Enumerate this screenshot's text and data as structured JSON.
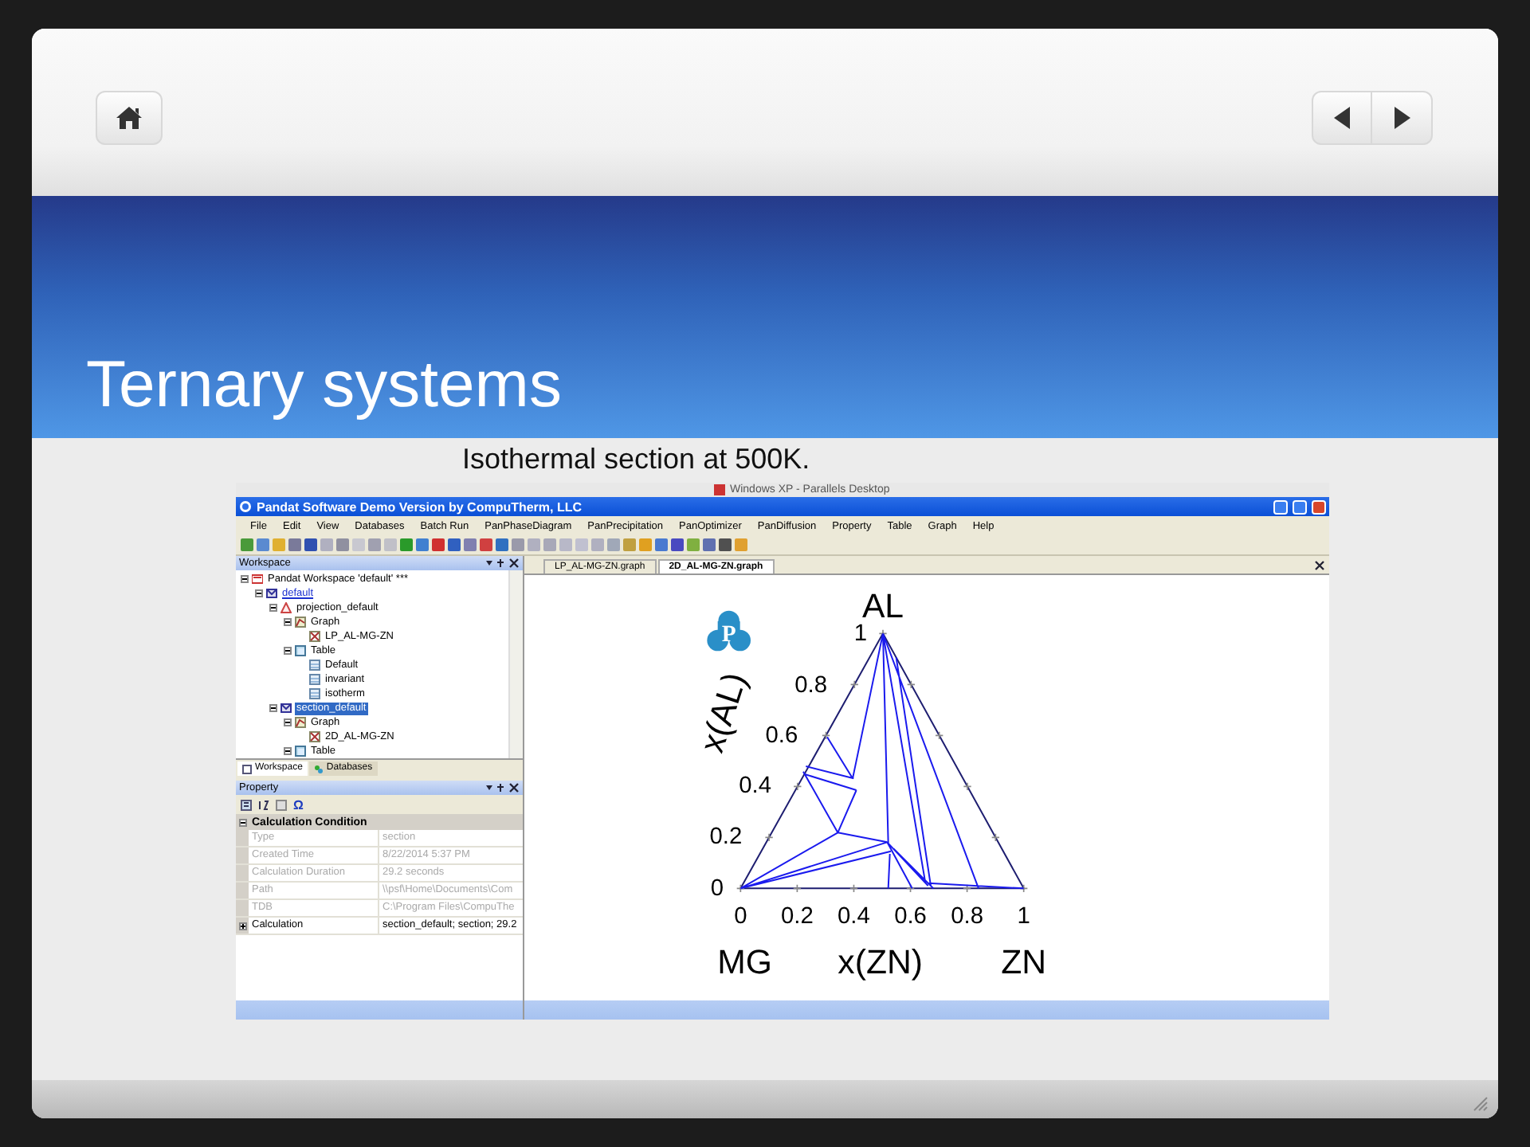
{
  "slide": {
    "title": "Ternary systems",
    "caption": "Isothermal section at 500K."
  },
  "screenshot": {
    "host_title": "Windows XP - Parallels Desktop",
    "window_title": "Pandat Software Demo Version by CompuTherm, LLC",
    "menu": [
      "File",
      "Edit",
      "View",
      "Databases",
      "Batch Run",
      "PanPhaseDiagram",
      "PanPrecipitation",
      "PanOptimizer",
      "PanDiffusion",
      "Property",
      "Table",
      "Graph",
      "Help"
    ],
    "workspace": {
      "title": "Workspace",
      "tree": [
        {
          "label": "Pandat Workspace 'default' ***",
          "kind": "workspace",
          "selected": false,
          "active": false,
          "expanded": true,
          "children": [
            {
              "label": "default",
              "kind": "case",
              "selected": false,
              "active": true,
              "expanded": true,
              "children": [
                {
                  "label": "projection_default",
                  "kind": "projection",
                  "selected": false,
                  "active": false,
                  "expanded": true,
                  "children": [
                    {
                      "label": "Graph",
                      "kind": "graph",
                      "selected": false,
                      "active": false,
                      "expanded": true,
                      "children": [
                        {
                          "label": "LP_AL-MG-ZN",
                          "kind": "plot",
                          "selected": false,
                          "active": false
                        }
                      ]
                    },
                    {
                      "label": "Table",
                      "kind": "table",
                      "selected": false,
                      "active": false,
                      "expanded": true,
                      "children": [
                        {
                          "label": "Default",
                          "kind": "sheet",
                          "selected": false,
                          "active": false
                        },
                        {
                          "label": "invariant",
                          "kind": "sheet",
                          "selected": false,
                          "active": false
                        },
                        {
                          "label": "isotherm",
                          "kind": "sheet",
                          "selected": false,
                          "active": false
                        }
                      ]
                    }
                  ]
                },
                {
                  "label": "section_default",
                  "kind": "case",
                  "selected": true,
                  "active": false,
                  "expanded": true,
                  "children": [
                    {
                      "label": "Graph",
                      "kind": "graph",
                      "selected": false,
                      "active": false,
                      "expanded": true,
                      "children": [
                        {
                          "label": "2D_AL-MG-ZN",
                          "kind": "plot",
                          "selected": false,
                          "active": false
                        }
                      ]
                    },
                    {
                      "label": "Table",
                      "kind": "table",
                      "selected": false,
                      "active": false,
                      "expanded": true
                    }
                  ]
                }
              ]
            }
          ]
        }
      ],
      "tabs": [
        {
          "label": "Workspace",
          "selected": true
        },
        {
          "label": "Databases",
          "selected": false
        }
      ]
    },
    "property": {
      "title": "Property",
      "toolbar_symbol": "Ω",
      "category": {
        "label": "Calculation Condition",
        "expanded": true
      },
      "rows": [
        {
          "kind": "field",
          "name": "Type",
          "value": "section",
          "disabled": true
        },
        {
          "kind": "field",
          "name": "Created Time",
          "value": "8/22/2014 5:37 PM",
          "disabled": true
        },
        {
          "kind": "field",
          "name": "Calculation Duration",
          "value": "29.2 seconds",
          "disabled": true
        },
        {
          "kind": "field",
          "name": "Path",
          "value": "\\\\psf\\Home\\Documents\\Com",
          "disabled": true
        },
        {
          "kind": "field",
          "name": "TDB",
          "value": "C:\\Program Files\\CompuThe",
          "disabled": true
        },
        {
          "kind": "group",
          "name": "Calculation",
          "value": "section_default; section; 29.2",
          "disabled": false,
          "expanded": false
        }
      ]
    },
    "graph_tabs": [
      {
        "label": "LP_AL-MG-ZN.graph",
        "selected": false
      },
      {
        "label": "2D_AL-MG-ZN.graph",
        "selected": true
      }
    ],
    "diagram": {
      "logo_letter": "P",
      "top_label": "AL",
      "left_label": "MG",
      "right_label": "ZN",
      "left_axis": "x(AL)",
      "bottom_axis": "x(ZN)",
      "left_ticks": [
        "0",
        "0.2",
        "0.4",
        "0.6",
        "0.8",
        "1"
      ],
      "bottom_ticks": [
        "0",
        "0.2",
        "0.4",
        "0.6",
        "0.8",
        "1"
      ]
    }
  }
}
